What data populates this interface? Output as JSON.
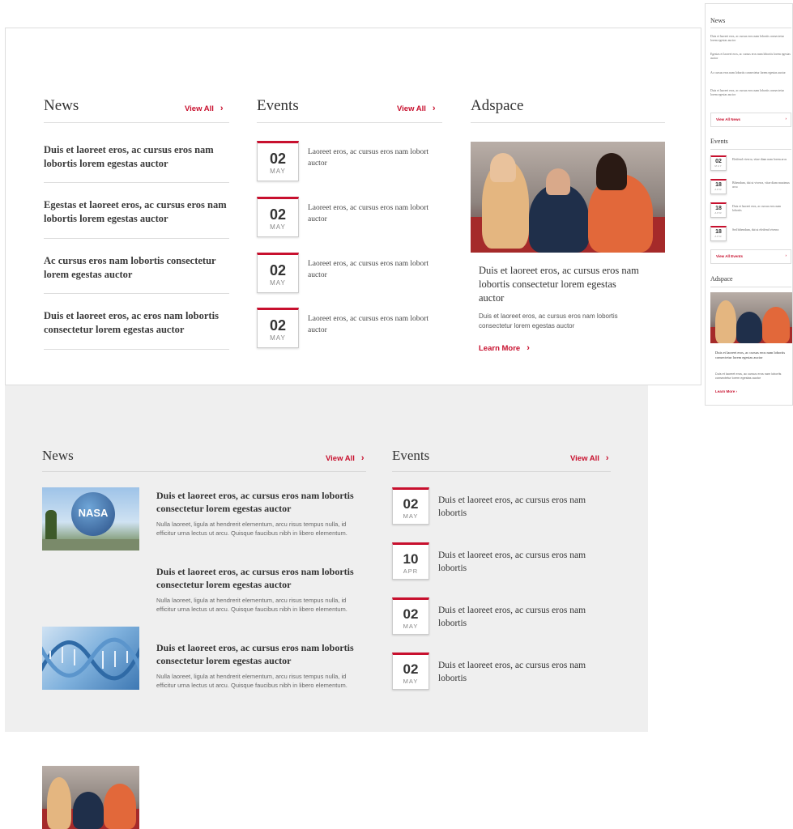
{
  "desktop_widget": {
    "news": {
      "title": "News",
      "view_all": "View All",
      "items": [
        "Duis et laoreet eros, ac cursus eros nam lobortis lorem egestas auctor",
        "Egestas et laoreet eros, ac cursus eros nam lobortis lorem egestas auctor",
        "Ac cursus eros nam lobortis consectetur lorem egestas auctor",
        "Duis et laoreet eros, ac eros nam lobortis consectetur lorem egestas auctor"
      ]
    },
    "events": {
      "title": "Events",
      "view_all": "View All",
      "items": [
        {
          "day": "02",
          "month": "MAY",
          "text": "Laoreet eros, ac cursus eros nam lobort auctor"
        },
        {
          "day": "02",
          "month": "MAY",
          "text": "Laoreet eros, ac cursus eros nam lobort auctor"
        },
        {
          "day": "02",
          "month": "MAY",
          "text": "Laoreet eros, ac cursus eros nam lobort auctor"
        },
        {
          "day": "02",
          "month": "MAY",
          "text": "Laoreet eros, ac cursus eros nam lobort auctor"
        }
      ]
    },
    "adspace": {
      "title": "Adspace",
      "headline": "Duis et laoreet eros, ac cursus eros nam lobortis consectetur lorem egestas auctor",
      "body": "Duis et laoreet eros, ac cursus eros nam lobortis consectetur lorem egestas auctor",
      "cta": "Learn More"
    }
  },
  "mobile_widget": {
    "news_title": "News",
    "news_items": [
      "Duis et laoreet eros, ac cursus eros nam lobortis consectetur lorem egestas auctor",
      "Egestas et laoreet eros, ac cursus eros nam lobortis lorem egestas auctor",
      "Ac cursus eros nam lobortis consectetur lorem egestas auctor",
      "Duis et laoreet eros, ac cursus eros nam lobortis consectetur lorem egestas auctor"
    ],
    "news_view_all": "View All News",
    "events_title": "Events",
    "events": [
      {
        "day": "02",
        "month": "MAY",
        "text": "Eleifend viverra, vitae diam nam lorem arcu"
      },
      {
        "day": "18",
        "month": "APR",
        "text": "Bibendum, dui ut viverra, vitae diam maximus arcu"
      },
      {
        "day": "18",
        "month": "APR",
        "text": "Duis et laoreet eros, ac cursus eros nam lobortis"
      },
      {
        "day": "18",
        "month": "APR",
        "text": "Sed bibendum, dui ut eleifend viverra"
      }
    ],
    "events_view_all": "View All Events",
    "adspace_title": "Adspace",
    "ad_headline": "Duis et laoreet eros, ac cursus eros nam lobortis consectetur lorem egestas auctor",
    "ad_body": "Duis et laoreet eros, ac cursus eros nam lobortis consectetur lorem egestas auctor",
    "ad_cta": "Learn More"
  },
  "grey_widget": {
    "news": {
      "title": "News",
      "view_all": "View All",
      "items": [
        {
          "headline": "Duis et laoreet eros, ac cursus eros nam lobortis consectetur lorem egestas auctor",
          "body": "Nulla laoreet, ligula at hendrerit elementum, arcu risus tempus nulla, id efficitur urna lectus ut arcu. Quisque faucibus nibh in libero elementum.",
          "thumb": "nasa-globe"
        },
        {
          "headline": "Duis et laoreet eros, ac cursus eros nam lobortis consectetur lorem egestas auctor",
          "body": "Nulla laoreet, ligula at hendrerit elementum, arcu risus tempus nulla, id efficitur urna lectus ut arcu. Quisque faucibus nibh in libero elementum.",
          "thumb": "dna-helix"
        },
        {
          "headline": "Duis et laoreet eros, ac cursus eros nam lobortis consectetur lorem egestas auctor",
          "body": "Nulla laoreet, ligula at hendrerit elementum, arcu risus tempus nulla, id efficitur urna lectus ut arcu. Quisque faucibus nibh in libero elementum.",
          "thumb": "students"
        }
      ]
    },
    "events": {
      "title": "Events",
      "view_all": "View All",
      "items": [
        {
          "day": "02",
          "month": "MAY",
          "text": "Duis et laoreet eros, ac cursus eros nam lobortis"
        },
        {
          "day": "10",
          "month": "APR",
          "text": "Duis et laoreet eros, ac cursus eros nam lobortis"
        },
        {
          "day": "02",
          "month": "MAY",
          "text": "Duis et laoreet eros, ac cursus eros nam lobortis"
        },
        {
          "day": "02",
          "month": "MAY",
          "text": "Duis et laoreet eros, ac cursus eros nam lobortis"
        }
      ]
    }
  },
  "colors": {
    "accent": "#c8102e",
    "grey_bg": "#efefef",
    "rule": "#dddddd"
  }
}
